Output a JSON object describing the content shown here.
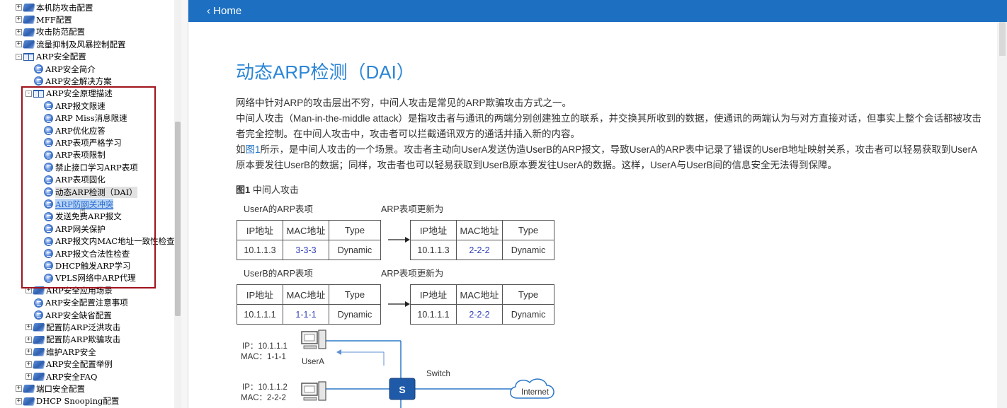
{
  "tree": {
    "items": [
      {
        "label": "本机防攻击配置",
        "expander": "+",
        "icon": "book"
      },
      {
        "label": "MFF配置",
        "expander": "+",
        "icon": "book"
      },
      {
        "label": "攻击防范配置",
        "expander": "+",
        "icon": "book"
      },
      {
        "label": "流量抑制及风暴控制配置",
        "expander": "+",
        "icon": "book"
      },
      {
        "label": "ARP安全配置",
        "expander": "-",
        "icon": "open"
      },
      {
        "label": "ARP安全简介",
        "expander": "",
        "icon": "page"
      },
      {
        "label": "ARP安全解决方案",
        "expander": "",
        "icon": "page"
      },
      {
        "label": "ARP安全原理描述",
        "expander": "-",
        "icon": "open"
      },
      {
        "label": "ARP报文限速",
        "expander": "",
        "icon": "page"
      },
      {
        "label": "ARP  Miss消息限速",
        "expander": "",
        "icon": "page"
      },
      {
        "label": "ARP优化应答",
        "expander": "",
        "icon": "page"
      },
      {
        "label": "ARP表项严格学习",
        "expander": "",
        "icon": "page"
      },
      {
        "label": "ARP表项限制",
        "expander": "",
        "icon": "page"
      },
      {
        "label": "禁止接口学习ARP表项",
        "expander": "",
        "icon": "page"
      },
      {
        "label": "ARP表项固化",
        "expander": "",
        "icon": "page"
      },
      {
        "label": "动态ARP检测（DAI）",
        "expander": "",
        "icon": "page"
      },
      {
        "label": "ARP防网关冲突",
        "expander": "",
        "icon": "page"
      },
      {
        "label": "发送免费ARP报文",
        "expander": "",
        "icon": "page"
      },
      {
        "label": "ARP网关保护",
        "expander": "",
        "icon": "page"
      },
      {
        "label": "ARP报文内MAC地址一致性检查",
        "expander": "",
        "icon": "page"
      },
      {
        "label": "ARP报文合法性检查",
        "expander": "",
        "icon": "page"
      },
      {
        "label": "DHCP触发ARP学习",
        "expander": "",
        "icon": "page"
      },
      {
        "label": "VPLS网络中ARP代理",
        "expander": "",
        "icon": "page"
      },
      {
        "label": "ARP安全应用场景",
        "expander": "+",
        "icon": "book"
      },
      {
        "label": "ARP安全配置注意事项",
        "expander": "",
        "icon": "page"
      },
      {
        "label": "ARP安全缺省配置",
        "expander": "",
        "icon": "page"
      },
      {
        "label": "配置防ARP泛洪攻击",
        "expander": "+",
        "icon": "book"
      },
      {
        "label": "配置防ARP欺骗攻击",
        "expander": "+",
        "icon": "book"
      },
      {
        "label": "维护ARP安全",
        "expander": "+",
        "icon": "book"
      },
      {
        "label": "ARP安全配置举例",
        "expander": "+",
        "icon": "book"
      },
      {
        "label": "ARP安全FAQ",
        "expander": "+",
        "icon": "book"
      },
      {
        "label": "端口安全配置",
        "expander": "+",
        "icon": "book"
      },
      {
        "label": "DHCP  Snooping配置",
        "expander": "+",
        "icon": "book"
      }
    ]
  },
  "header": {
    "home_label": "Home",
    "color": "#1c6fc1"
  },
  "article": {
    "title": "动态ARP检测（DAI）",
    "p1": "网络中针对ARP的攻击层出不穷，中间人攻击是常见的ARP欺骗攻击方式之一。",
    "p2": "中间人攻击（Man-in-the-middle attack）是指攻击者与通讯的两端分别创建独立的联系，并交换其所收到的数据，使通讯的两端认为与对方直接对话，但事实上整个会话都被攻击者完全控制。在中间人攻击中，攻击者可以拦截通讯双方的通话并插入新的内容。",
    "p3_prefix": "如",
    "p3_link": "图1",
    "p3_rest": "所示，是中间人攻击的一个场景。攻击者主动向UserA发送伪造UserB的ARP报文，导致UserA的ARP表中记录了错误的UserB地址映射关系，攻击者可以轻易获取到UserA原本要发往UserB的数据；同样，攻击者也可以轻易获取到UserB原本要发往UserA的数据。这样，UserA与UserB间的信息安全无法得到保障。",
    "figure_caption_num": "图1",
    "figure_caption_text": "中间人攻击"
  },
  "figure": {
    "usera_label": "UserA的ARP表项",
    "userb_label": "UserB的ARP表项",
    "updated_label": "ARP表项更新为",
    "headers": [
      "IP地址",
      "MAC地址",
      "Type"
    ],
    "tableA_before": [
      "10.1.1.3",
      "3-3-3",
      "Dynamic"
    ],
    "tableA_after": [
      "10.1.1.3",
      "2-2-2",
      "Dynamic"
    ],
    "tableB_before": [
      "10.1.1.1",
      "1-1-1",
      "Dynamic"
    ],
    "tableB_after": [
      "10.1.1.1",
      "2-2-2",
      "Dynamic"
    ],
    "hostA_ip": "IP：10.1.1.1",
    "hostA_mac": "MAC：1-1-1",
    "hostA_name": "UserA",
    "hostB_ip": "IP：10.1.1.2",
    "hostB_mac": "MAC：2-2-2",
    "switch_label": "Switch",
    "switch_icon_text": "S",
    "cloud_label": "Internet"
  }
}
